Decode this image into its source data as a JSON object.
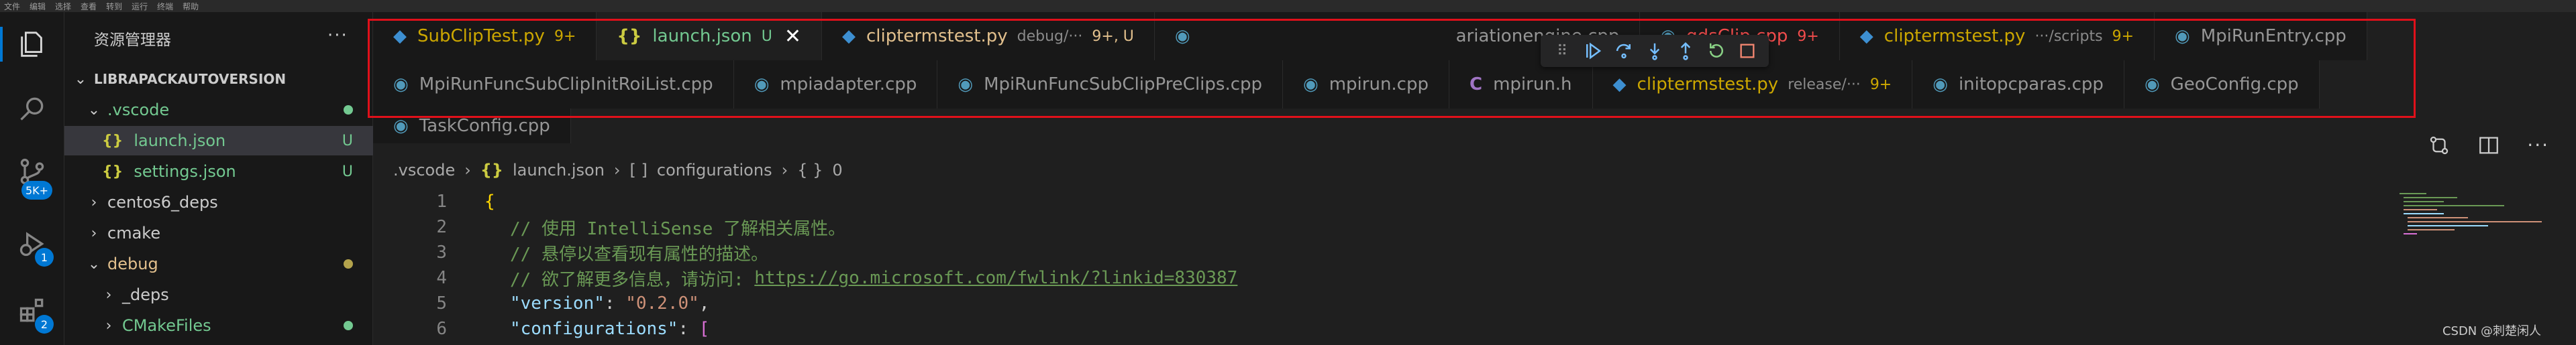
{
  "menubar": [
    "文件",
    "编辑",
    "选择",
    "查看",
    "转到",
    "运行",
    "终端",
    "帮助"
  ],
  "activity": {
    "source_control_badge": "5K+",
    "debug_badge": "1",
    "extensions_badge": "2"
  },
  "sidebar": {
    "title": "资源管理器",
    "more": "···",
    "root": "LIBRAPACKAUTOVERSION",
    "items": [
      {
        "label": "vscode_folder",
        "text": ".vscode"
      },
      {
        "label": "launch",
        "text": "launch.json",
        "status": "U"
      },
      {
        "label": "settings",
        "text": "settings.json",
        "status": "U"
      },
      {
        "label": "centos",
        "text": "centos6_deps"
      },
      {
        "label": "cmake",
        "text": "cmake"
      },
      {
        "label": "debug",
        "text": "debug"
      },
      {
        "label": "deps",
        "text": "_deps"
      },
      {
        "label": "cmakefiles",
        "text": "CMakeFiles"
      }
    ]
  },
  "tabs_row1": [
    {
      "name": "SubClipTest.py",
      "status": "9+"
    },
    {
      "name": "launch.json",
      "status": "U"
    },
    {
      "name": "cliptermstest.py",
      "desc": "debug/···",
      "status": "9+, U"
    },
    {
      "name": "ariationengine.cpp"
    },
    {
      "name": "gdsClip.cpp",
      "status": "9+"
    },
    {
      "name": "cliptermstest.py",
      "desc": "···/scripts",
      "status": "9+"
    },
    {
      "name": "MpiRunEntry.cpp"
    }
  ],
  "tabs_row2": [
    {
      "name": "MpiRunFuncSubClipInitRoiList.cpp"
    },
    {
      "name": "mpiadapter.cpp"
    },
    {
      "name": "MpiRunFuncSubClipPreClips.cpp"
    },
    {
      "name": "mpirun.cpp"
    },
    {
      "name": "mpirun.h"
    },
    {
      "name": "cliptermstest.py",
      "desc": "release/···",
      "status": "9+"
    },
    {
      "name": "initopcparas.cpp"
    },
    {
      "name": "GeoConfig.cpp"
    }
  ],
  "tabs_row3": [
    {
      "name": "TaskConfig.cpp"
    }
  ],
  "breadcrumb": {
    "folder": ".vscode",
    "file": "launch.json",
    "node1": "configurations",
    "node2": "0"
  },
  "code": {
    "lines": [
      "1",
      "2",
      "3",
      "4",
      "5",
      "6"
    ],
    "l1": "{",
    "l2": "// 使用 IntelliSense 了解相关属性。",
    "l3": "// 悬停以查看现有属性的描述。",
    "l4_prefix": "// 欲了解更多信息，请访问: ",
    "l4_link": "https://go.microsoft.com/fwlink/?linkid=830387",
    "l5_key": "\"version\"",
    "l5_val": "\"0.2.0\"",
    "l6_key": "\"configurations\"",
    "l6_val": "["
  },
  "watermark": "CSDN @刺楚闲人",
  "colors": {
    "accent": "#0078d4",
    "highlight": "#e0101a",
    "git_untracked": "#73c991",
    "git_modified": "#b3a34c",
    "python_tab": "#e2c08d",
    "warning_tab": "#cca700",
    "error_tab": "#f14c4c"
  }
}
